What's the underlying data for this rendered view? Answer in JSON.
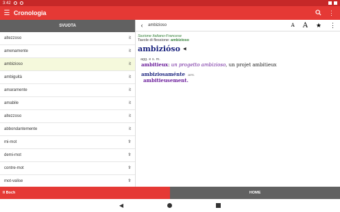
{
  "statusbar": {
    "time": "3:42"
  },
  "appbar": {
    "title": "Cronologia"
  },
  "history": {
    "clear_label": "SVUOTA",
    "items": [
      {
        "word": "altezzoso",
        "lang": "it"
      },
      {
        "word": "amenamente",
        "lang": "it"
      },
      {
        "word": "ambizioso",
        "lang": "it"
      },
      {
        "word": "ambiguità",
        "lang": "it"
      },
      {
        "word": "amaramente",
        "lang": "it"
      },
      {
        "word": "amabile",
        "lang": "it"
      },
      {
        "word": "altezzoso",
        "lang": "it"
      },
      {
        "word": "abbondantemente",
        "lang": "it"
      },
      {
        "word": "mi-mot",
        "lang": "fr"
      },
      {
        "word": "demi-mot",
        "lang": "fr"
      },
      {
        "word": "contre-mot",
        "lang": "fr"
      },
      {
        "word": "mot-valise",
        "lang": "fr"
      }
    ]
  },
  "search": {
    "query": "ambizioso"
  },
  "entry": {
    "section_prefix": "Sezione",
    "section_name": "Italiano-Francese",
    "flex_label": "Tavole di flessione:",
    "flex_word": "ambizioso",
    "headword": "ambizióso",
    "grammar": "agg. e s. m.",
    "translation_word": "ambitieux",
    "translation_example": "un progetto ambizioso",
    "translation_example_fr": ", un projet ambitieux",
    "adverb": "ambiziosaménte",
    "adverb_tag": "avv.",
    "adverb_translation": "ambitieusement."
  },
  "tabs": {
    "left": "Il Boch",
    "right": "HOME"
  }
}
